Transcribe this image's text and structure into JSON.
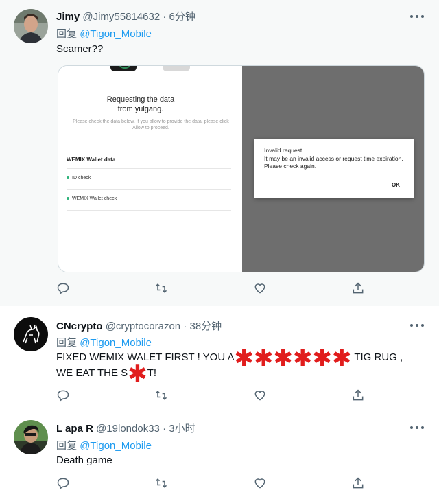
{
  "tweets": [
    {
      "name": "Jimy",
      "handle": "@Jimy55814632",
      "dot": "·",
      "time": "6分钟",
      "reply_prefix": "回复",
      "reply_to": "@Tigon_Mobile",
      "text": "Scamer??",
      "card": {
        "title_line1": "Requesting the data",
        "title_line2": "from yulgang.",
        "subtitle": "Please check the data below. If you allow to provide the data, please click Allow to proceed.",
        "wallet_header": "WEMIX Wallet data",
        "items": [
          "ID check",
          "WEMIX Wallet check"
        ],
        "dialog_title": "Invalid request.",
        "dialog_body": "It may be an invalid access or request time expiration. Please check again.",
        "dialog_ok": "OK"
      }
    },
    {
      "name": "CNcrypto",
      "handle": "@cryptocorazon",
      "dot": "·",
      "time": "38分钟",
      "reply_prefix": "回复",
      "reply_to": "@Tigon_Mobile",
      "text_part1": "FIXED WEMIX WALET FIRST ! YOU A",
      "text_redact1": "✱✱✱✱✱✱",
      "text_part2": " TIG RUG ,",
      "text_part3": "WE EAT THE S",
      "text_redact2": "✱",
      "text_part4": "T!"
    },
    {
      "name": "L apa R",
      "handle": "@19londok33",
      "dot": "·",
      "time": "3小时",
      "reply_prefix": "回复",
      "reply_to": "@Tigon_Mobile",
      "text": "Death game"
    }
  ],
  "icons": [
    "reply-icon",
    "retweet-icon",
    "like-icon",
    "share-icon",
    "more-icon"
  ],
  "colors": {
    "link": "#1d9bf0",
    "muted": "#536471",
    "redaction": "#e11d1d"
  }
}
